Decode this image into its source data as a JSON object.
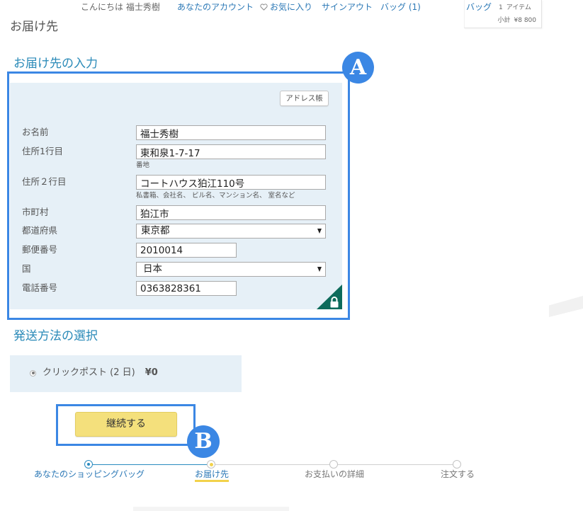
{
  "header": {
    "greeting": "こんにちは 福士秀樹",
    "account_link": "あなたのアカウント",
    "favorites_link": "お気に入り",
    "signout_link": "サインアウト",
    "bag_link": "バッグ (1)"
  },
  "mini_bag": {
    "label": "バッグ",
    "item_count": "1",
    "item_unit": "アイテム",
    "subtotal_label": "小計",
    "subtotal": "¥8 800"
  },
  "page_title": "お届け先",
  "address_section": {
    "title": "お届け先の入力",
    "address_book_button": "アドレス帳",
    "fields": {
      "name": {
        "label": "お名前",
        "value": "福士秀樹"
      },
      "address1": {
        "label": "住所1行目",
        "value": "東和泉1-7-17",
        "hint": "番地"
      },
      "address2": {
        "label": "住所２行目",
        "value": "コートハウス狛江110号",
        "hint": "私書箱、会社名、 ビル名、マンション名、 室名など"
      },
      "city": {
        "label": "市町村",
        "value": "狛江市"
      },
      "prefecture": {
        "label": "都道府県",
        "value": "東京都"
      },
      "postal_code": {
        "label": "郵便番号",
        "value": "2010014"
      },
      "country": {
        "label": "国",
        "value": "日本"
      },
      "phone": {
        "label": "電話番号",
        "value": "0363828361"
      }
    }
  },
  "shipping_section": {
    "title": "発送方法の選択",
    "option": {
      "label": "クリックポスト (2 日)",
      "price": "¥0",
      "selected": true
    }
  },
  "continue_button": "継続する",
  "annotations": {
    "a": "A",
    "b": "B"
  },
  "progress": {
    "current_step": 2,
    "steps": [
      "あなたのショッピングバッグ",
      "お届け先",
      "お支払いの詳細",
      "注文する"
    ]
  },
  "icons": {
    "favorites": "heart-icon",
    "select_arrow": "chevron-down-icon",
    "secure": "lock-icon"
  },
  "colors": {
    "link": "#2b78b6",
    "section_title": "#2a8ab8",
    "highlight": "#3b87e4",
    "panel_bg": "#e6f0f7",
    "continue_button": "#f4e07c",
    "secure_badge": "#0d6b5b",
    "progress_active": "#2a8bc0",
    "current_step_dot": "#f2d24b"
  }
}
